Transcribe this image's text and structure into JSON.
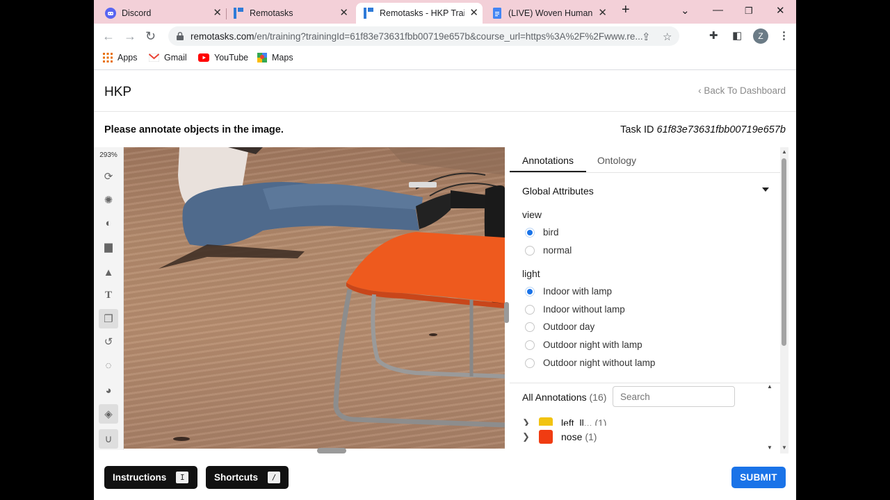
{
  "browser": {
    "tabs": [
      {
        "title": "Discord",
        "icon": "discord-icon"
      },
      {
        "title": "Remotasks",
        "icon": "remotasks-icon"
      },
      {
        "title": "Remotasks - HKP Traini",
        "icon": "remotasks-icon",
        "active": true
      },
      {
        "title": "(LIVE) Woven Human K",
        "icon": "google-docs-icon"
      }
    ],
    "url_host": "remotasks.com",
    "url_rest": "/en/training?trainingId=61f83e73631fbb00719e657b&course_url=https%3A%2F%2Fwww.re...",
    "profile_initial": "Z",
    "bookmarks": [
      {
        "label": "Apps",
        "icon": "apps-grid-icon"
      },
      {
        "label": "Gmail",
        "icon": "gmail-icon"
      },
      {
        "label": "YouTube",
        "icon": "youtube-icon"
      },
      {
        "label": "Maps",
        "icon": "maps-icon"
      }
    ]
  },
  "app": {
    "title": "HKP",
    "back_label": "Back To Dashboard",
    "instruction": "Please annotate objects in the image.",
    "task_id_label": "Task ID",
    "task_id": "61f83e73631fbb00719e657b"
  },
  "toolbar": {
    "zoom": "293%",
    "tools": [
      "rotate-icon",
      "brightness-icon",
      "contrast-icon",
      "paint-roller-icon",
      "shapes-icon",
      "text-icon",
      "layers-icon",
      "history-icon",
      "hide-icon",
      "palette-icon",
      "fill-icon",
      "magnet-icon"
    ]
  },
  "panel": {
    "tabs": [
      "Annotations",
      "Ontology"
    ],
    "global_attributes": "Global Attributes",
    "view": {
      "label": "view",
      "options": [
        "bird",
        "normal"
      ],
      "selected": "bird"
    },
    "light": {
      "label": "light",
      "options": [
        "Indoor with lamp",
        "Indoor without lamp",
        "Outdoor day",
        "Outdoor night with lamp",
        "Outdoor night without lamp"
      ],
      "selected": "Indoor with lamp"
    },
    "all_annotations_label": "All Annotations",
    "all_annotations_count": "(16)",
    "search_placeholder": "Search",
    "annotations": [
      {
        "name": "left_ll...",
        "count": "(1)",
        "color": "#f2c311"
      },
      {
        "name": "nose",
        "count": "(1)",
        "color": "#f03c12"
      }
    ]
  },
  "footer": {
    "instructions_label": "Instructions",
    "instructions_key": "I",
    "shortcuts_label": "Shortcuts",
    "shortcuts_key": "/",
    "submit_label": "SUBMIT"
  },
  "colors": {
    "tabbar": "#f3d0d8",
    "accent": "#1a73e8"
  }
}
